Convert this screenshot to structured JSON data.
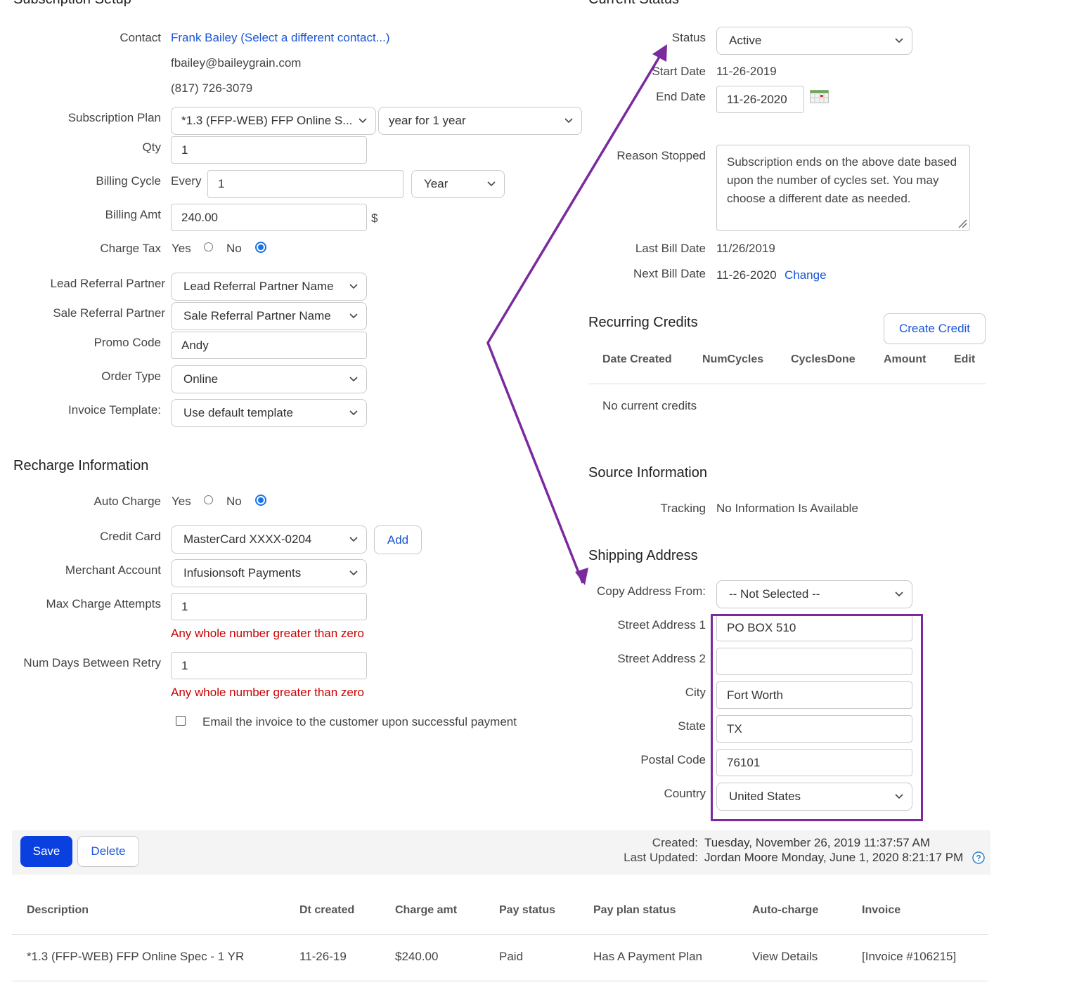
{
  "setup": {
    "title": "Subscription Setup",
    "contact_label": "Contact",
    "contact_name": "Frank Bailey",
    "contact_change": "(Select a different contact...)",
    "email": "fbailey@baileygrain.com",
    "phone": "(817) 726-3079",
    "plan_label": "Subscription Plan",
    "plan_value": "*1.3 (FFP-WEB) FFP Online S...",
    "plan_term": "year for 1 year",
    "qty_label": "Qty",
    "qty_value": "1",
    "cycle_label": "Billing Cycle",
    "cycle_every": "Every",
    "cycle_value": "1",
    "cycle_unit": "Year",
    "amt_label": "Billing Amt",
    "amt_value": "240.00",
    "amt_currency": "$",
    "tax_label": "Charge Tax",
    "yes": "Yes",
    "no": "No",
    "lead_label": "Lead Referral Partner",
    "lead_value": "Lead Referral Partner Name",
    "sale_label": "Sale Referral Partner",
    "sale_value": "Sale Referral Partner Name",
    "promo_label": "Promo Code",
    "promo_value": "Andy",
    "order_label": "Order Type",
    "order_value": "Online",
    "invoice_label": "Invoice Template:",
    "invoice_value": "Use default template"
  },
  "recharge": {
    "title": "Recharge Information",
    "auto_label": "Auto Charge",
    "yes": "Yes",
    "no": "No",
    "card_label": "Credit Card",
    "card_value": "MasterCard XXXX-0204",
    "add": "Add",
    "merchant_label": "Merchant Account",
    "merchant_value": "Infusionsoft Payments",
    "max_label": "Max Charge Attempts",
    "max_value": "1",
    "max_hint": "Any whole number greater than zero",
    "retry_label": "Num Days Between Retry",
    "retry_value": "1",
    "retry_hint": "Any whole number greater than zero",
    "email_checkbox": "Email the invoice to the customer upon successful payment"
  },
  "status": {
    "title": "Current Status",
    "status_label": "Status",
    "status_value": "Active",
    "start_label": "Start Date",
    "start_value": "11-26-2019",
    "end_label": "End Date",
    "end_value": "11-26-2020",
    "reason_label": "Reason Stopped",
    "reason_value": "Subscription ends on the above date based upon the number of cycles set. You may choose a different date as needed.",
    "last_label": "Last Bill Date",
    "last_value": "11/26/2019",
    "next_label": "Next Bill Date",
    "next_value": "11-26-2020",
    "change": "Change"
  },
  "credits": {
    "title": "Recurring Credits",
    "create": "Create Credit",
    "columns": [
      "Date Created",
      "NumCycles",
      "CyclesDone",
      "Amount",
      "Edit"
    ],
    "empty": "No current credits"
  },
  "source": {
    "title": "Source Information",
    "tracking_label": "Tracking",
    "tracking_value": "No Information Is Available"
  },
  "shipping": {
    "title": "Shipping Address",
    "copy_label": "Copy Address From:",
    "copy_value": "-- Not Selected --",
    "street1_label": "Street Address 1",
    "street1_value": "PO BOX 510",
    "street2_label": "Street Address 2",
    "street2_value": "",
    "city_label": "City",
    "city_value": "Fort Worth",
    "state_label": "State",
    "state_value": "TX",
    "postal_label": "Postal Code",
    "postal_value": "76101",
    "country_label": "Country",
    "country_value": "United States"
  },
  "footer": {
    "save": "Save",
    "delete": "Delete",
    "created_label": "Created:",
    "created_value": "Tuesday, November 26, 2019 11:37:57 AM",
    "updated_label": "Last Updated:",
    "updated_user": "Jordan Moore",
    "updated_value": "Monday, June 1, 2020 8:21:17 PM"
  },
  "table": {
    "columns": [
      "Description",
      "Dt created",
      "Charge amt",
      "Pay status",
      "Pay plan status",
      "Auto-charge",
      "Invoice"
    ],
    "row": {
      "description": "*1.3 (FFP-WEB) FFP Online Spec - 1 YR",
      "created": "11-26-19",
      "amount": "$240.00",
      "pay_status": "Paid",
      "plan_status": "Has A Payment Plan",
      "auto_charge": "View Details",
      "invoice": "[Invoice #106215]"
    }
  },
  "colors": {
    "accent": "#1a56d6",
    "primary_button": "#0a3fe0",
    "error": "#cc0000",
    "annotation": "#7b2a9e"
  }
}
